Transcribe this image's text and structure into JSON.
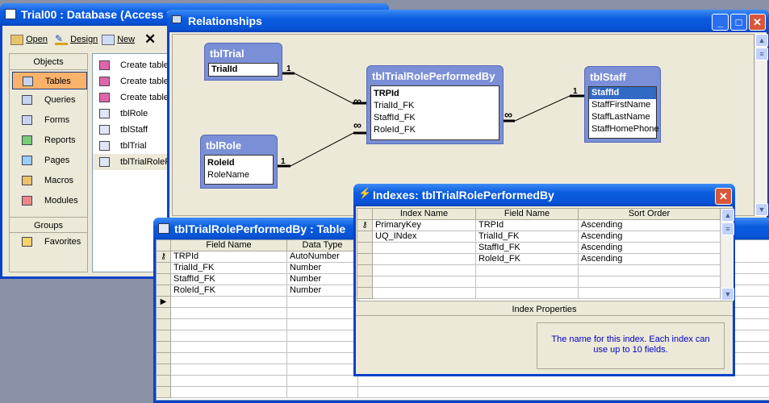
{
  "db_window": {
    "title": "Trial00 : Database (Access 20",
    "toolbar": {
      "open": "Open",
      "design": "Design",
      "new": "New",
      "delete_icon": "close-x"
    },
    "objects_header": "Objects",
    "objects": [
      {
        "label": "Tables",
        "icon": "table-icon",
        "selected": true
      },
      {
        "label": "Queries",
        "icon": "query-icon"
      },
      {
        "label": "Forms",
        "icon": "form-icon"
      },
      {
        "label": "Reports",
        "icon": "report-icon"
      },
      {
        "label": "Pages",
        "icon": "page-icon"
      },
      {
        "label": "Macros",
        "icon": "macro-icon"
      },
      {
        "label": "Modules",
        "icon": "module-icon"
      }
    ],
    "groups_header": "Groups",
    "groups": [
      {
        "label": "Favorites",
        "icon": "favorites-icon"
      }
    ],
    "list": [
      "Create table",
      "Create table",
      "Create table",
      "tblRole",
      "tblStaff",
      "tblTrial",
      "tblTrialRoleP"
    ]
  },
  "relationships": {
    "title": "Relationships",
    "tables": [
      {
        "name": "tblTrial",
        "fields": [
          "TrialId"
        ],
        "key": [
          "TrialId"
        ]
      },
      {
        "name": "tblTrialRolePerformedBy",
        "fields": [
          "TRPId",
          "TrialId_FK",
          "StaffId_FK",
          "RoleId_FK"
        ],
        "key": [
          "TRPId"
        ]
      },
      {
        "name": "tblStaff",
        "fields": [
          "StaffId",
          "StaffFirstName",
          "StaffLastName",
          "StaffHomePhone"
        ],
        "key": [
          "StaffId"
        ]
      },
      {
        "name": "tblRole",
        "fields": [
          "RoleId",
          "RoleName"
        ],
        "key": [
          "RoleId"
        ]
      }
    ],
    "labels": {
      "one": "1",
      "many": "∞"
    }
  },
  "table_design": {
    "title": "tblTrialRolePerformedBy : Table",
    "columns": [
      "Field Name",
      "Data Type"
    ],
    "rows": [
      [
        "TRPId",
        "AutoNumber"
      ],
      [
        "TrialId_FK",
        "Number"
      ],
      [
        "StaffId_FK",
        "Number"
      ],
      [
        "RoleId_FK",
        "Number"
      ]
    ]
  },
  "indexes": {
    "title": "Indexes: tblTrialRolePerformedBy",
    "columns": [
      "Index Name",
      "Field Name",
      "Sort Order"
    ],
    "rows": [
      [
        "PrimaryKey",
        "TRPId",
        "Ascending"
      ],
      [
        "UQ_INdex",
        "TrialId_FK",
        "Ascending"
      ],
      [
        "",
        "StaffId_FK",
        "Ascending"
      ],
      [
        "",
        "RoleId_FK",
        "Ascending"
      ]
    ],
    "properties_header": "Index Properties",
    "help_text": "The name for this index.  Each index can use up to 10 fields.",
    "help_color": "#0000c0"
  },
  "colors": {
    "titlebar": "#0853d6",
    "selected_object": "#fbb36b",
    "table_box": "#7b8fd6"
  }
}
